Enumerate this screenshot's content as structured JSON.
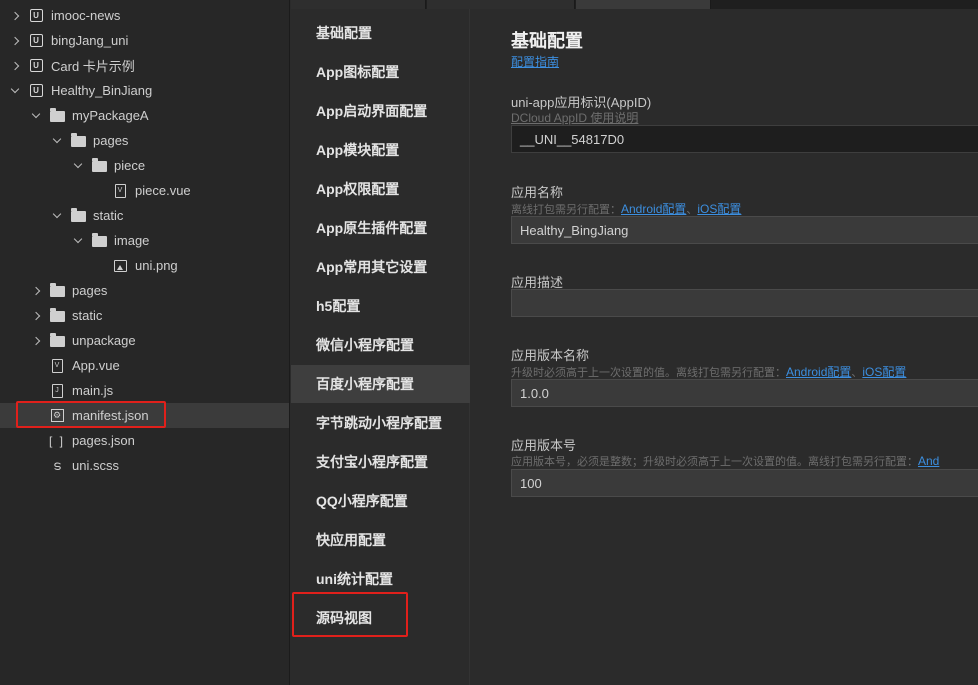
{
  "explorer": {
    "items": [
      {
        "label": "imooc-news",
        "icon": "project-icon",
        "arrow": "right",
        "depth": 0
      },
      {
        "label": "bingJang_uni",
        "icon": "project-icon",
        "arrow": "right",
        "depth": 0
      },
      {
        "label": "Card 卡片示例",
        "icon": "project-icon",
        "arrow": "right",
        "depth": 0
      },
      {
        "label": "Healthy_BinJiang",
        "icon": "project-icon",
        "arrow": "down",
        "depth": 0
      },
      {
        "label": "myPackageA",
        "icon": "folder-icon",
        "arrow": "down",
        "depth": 1
      },
      {
        "label": "pages",
        "icon": "folder-icon",
        "arrow": "down",
        "depth": 2
      },
      {
        "label": "piece",
        "icon": "folder-icon",
        "arrow": "down",
        "depth": 3
      },
      {
        "label": "piece.vue",
        "icon": "vue-file-icon",
        "arrow": "none",
        "depth": 4
      },
      {
        "label": "static",
        "icon": "folder-icon",
        "arrow": "down",
        "depth": 2
      },
      {
        "label": "image",
        "icon": "folder-icon",
        "arrow": "down",
        "depth": 3
      },
      {
        "label": "uni.png",
        "icon": "image-file-icon",
        "arrow": "none",
        "depth": 4
      },
      {
        "label": "pages",
        "icon": "folder-icon",
        "arrow": "right",
        "depth": 1
      },
      {
        "label": "static",
        "icon": "folder-icon",
        "arrow": "right",
        "depth": 1
      },
      {
        "label": "unpackage",
        "icon": "folder-icon",
        "arrow": "right",
        "depth": 1
      },
      {
        "label": "App.vue",
        "icon": "vue-file-icon",
        "arrow": "none",
        "depth": 1
      },
      {
        "label": "main.js",
        "icon": "js-file-icon",
        "arrow": "none",
        "depth": 1
      },
      {
        "label": "manifest.json",
        "icon": "settings-file-icon",
        "arrow": "none",
        "depth": 1,
        "selected": true
      },
      {
        "label": "pages.json",
        "icon": "json-file-icon",
        "arrow": "none",
        "depth": 1
      },
      {
        "label": "uni.scss",
        "icon": "scss-file-icon",
        "arrow": "none",
        "depth": 1
      }
    ]
  },
  "config_nav": {
    "items": [
      {
        "label": "基础配置"
      },
      {
        "label": "App图标配置"
      },
      {
        "label": "App启动界面配置"
      },
      {
        "label": "App模块配置"
      },
      {
        "label": "App权限配置"
      },
      {
        "label": "App原生插件配置"
      },
      {
        "label": "App常用其它设置"
      },
      {
        "label": "h5配置"
      },
      {
        "label": "微信小程序配置"
      },
      {
        "label": "百度小程序配置",
        "active": true
      },
      {
        "label": "字节跳动小程序配置"
      },
      {
        "label": "支付宝小程序配置"
      },
      {
        "label": "QQ小程序配置"
      },
      {
        "label": "快应用配置"
      },
      {
        "label": "uni统计配置"
      },
      {
        "label": "源码视图"
      }
    ]
  },
  "content": {
    "title": "基础配置",
    "guide_link": "配置指南",
    "appid": {
      "label": "uni-app应用标识(AppID)",
      "help_link": "DCloud AppID 使用说明",
      "value": "__UNI__54817D0"
    },
    "app_name": {
      "label": "应用名称",
      "sub": "离线打包需另行配置：",
      "android_link": "Android配置",
      "sep": "、",
      "ios_link": "iOS配置",
      "value": "Healthy_BingJiang"
    },
    "description": {
      "label": "应用描述",
      "value": ""
    },
    "version_name": {
      "label": "应用版本名称",
      "sub": "升级时必须高于上一次设置的值。离线打包需另行配置：",
      "android_link": "Android配置",
      "sep": "、",
      "ios_link": "iOS配置",
      "value": "1.0.0"
    },
    "version_code": {
      "label": "应用版本号",
      "sub": "应用版本号，必须是整数；升级时必须高于上一次设置的值。离线打包需另行配置：",
      "android_link": "And",
      "value": "100"
    }
  },
  "colors": {
    "highlight_box": "#e0201b",
    "link": "#3c8fe0"
  }
}
